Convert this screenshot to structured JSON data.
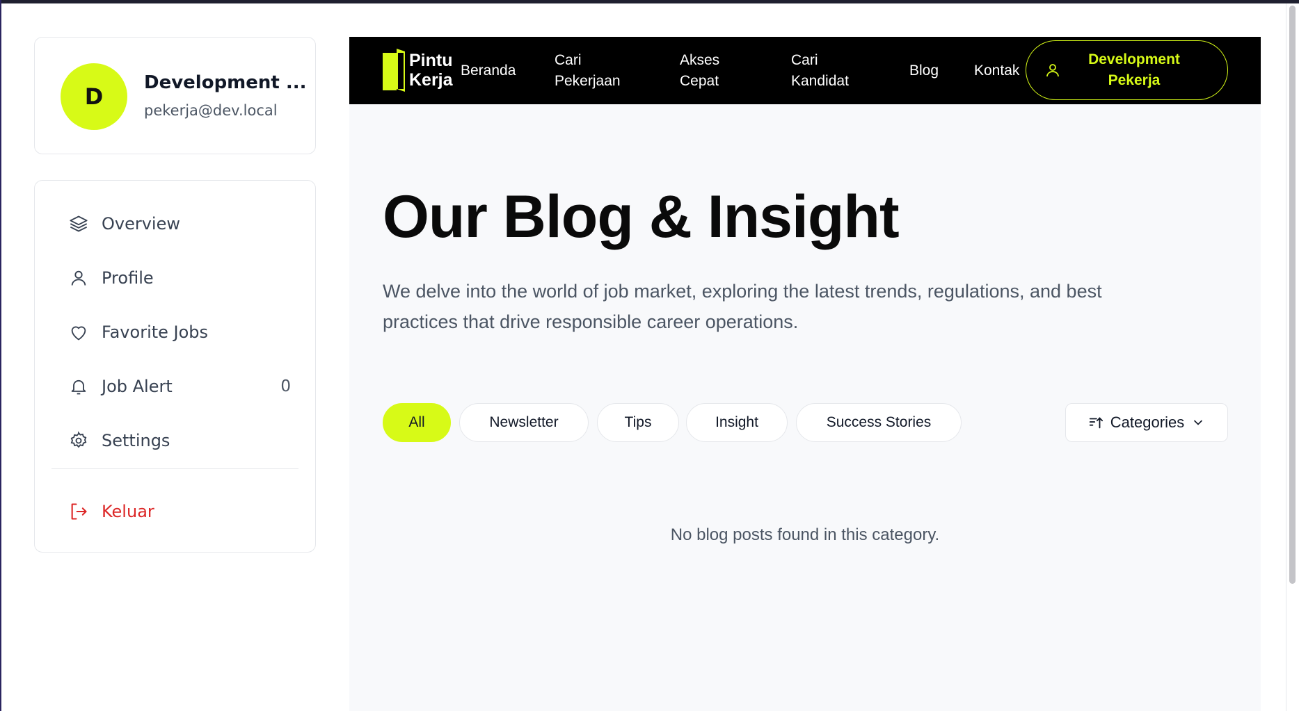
{
  "profile": {
    "avatar_initial": "D",
    "name": "Development ...",
    "email": "pekerja@dev.local"
  },
  "sidebar": {
    "items": [
      {
        "label": "Overview",
        "icon": "layers-icon"
      },
      {
        "label": "Profile",
        "icon": "user-icon"
      },
      {
        "label": "Favorite Jobs",
        "icon": "heart-icon"
      },
      {
        "label": "Job Alert",
        "icon": "bell-icon",
        "count": "0"
      },
      {
        "label": "Settings",
        "icon": "gear-icon"
      }
    ],
    "logout": {
      "label": "Keluar",
      "icon": "logout-icon"
    }
  },
  "navbar": {
    "logo_line1": "Pintu",
    "logo_line2": "Kerja",
    "links": [
      "Beranda",
      "Cari Pekerjaan",
      "Akses Cepat",
      "Cari Kandidat",
      "Blog",
      "Kontak"
    ],
    "user_button": "Development Pekerja"
  },
  "hero": {
    "title": "Our Blog & Insight",
    "description": "We delve into the world of job market, exploring the latest trends, regulations, and best practices that drive responsible career operations."
  },
  "filters": {
    "tabs": [
      "All",
      "Newsletter",
      "Tips",
      "Insight",
      "Success Stories"
    ],
    "active": "All",
    "categories_label": "Categories"
  },
  "empty_message": "No blog posts found in this category.",
  "colors": {
    "accent": "#d7fa17",
    "danger": "#dc2626",
    "navbar_bg": "#000000",
    "panel_bg": "#f8f9fb"
  }
}
